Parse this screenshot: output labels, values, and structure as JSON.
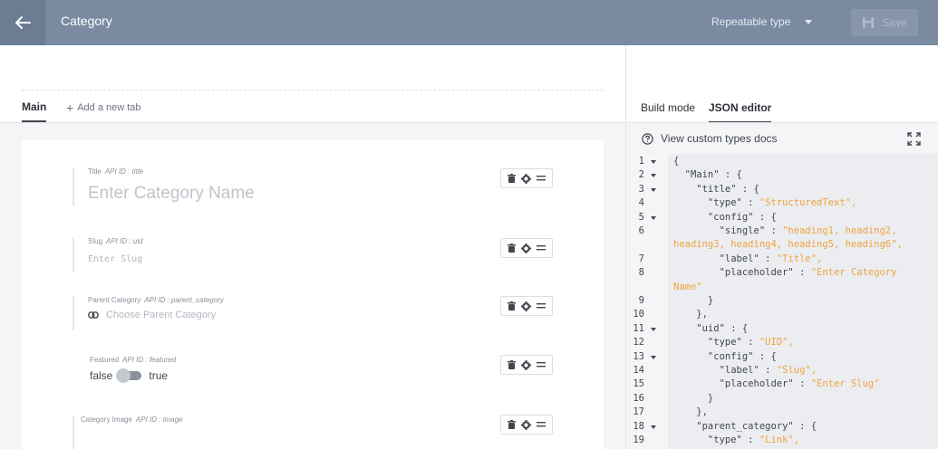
{
  "header": {
    "title": "Category",
    "type_select": "Repeatable type",
    "save_label": "Save"
  },
  "tabs": {
    "main": "Main",
    "add": "Add a new tab"
  },
  "fields": [
    {
      "label": "Title",
      "api": "API ID : title",
      "placeholder": "Enter Category Name"
    },
    {
      "label": "Slug",
      "api": "API ID : uid",
      "placeholder": "Enter Slug"
    },
    {
      "label": "Parent Category",
      "api": "API ID : parent_category",
      "placeholder": "Choose Parent Category"
    },
    {
      "label": "Featured",
      "api": "API ID : featured",
      "false_label": "false",
      "true_label": "true"
    },
    {
      "label": "Category Image",
      "api": "API ID : image"
    }
  ],
  "right": {
    "build_mode": "Build mode",
    "json_editor": "JSON editor",
    "docs_link": "View custom types docs"
  },
  "code": {
    "line_numbers": [
      "1",
      "2",
      "3",
      "4",
      "5",
      "6",
      "",
      "7",
      "8",
      "",
      "9",
      "10",
      "11",
      "12",
      "13",
      "14",
      "15",
      "16",
      "17",
      "18",
      "19"
    ],
    "lines": [
      "{",
      "  \"Main\" : {",
      "    \"title\" : {",
      "      \"type\" : ",
      "      \"config\" : {",
      "        \"single\" : ",
      "",
      "        \"label\" : ",
      "        \"placeholder\" : ",
      "",
      "      }",
      "    },",
      "    \"uid\" : {",
      "      \"type\" : ",
      "      \"config\" : {",
      "        \"label\" : ",
      "        \"placeholder\" : ",
      "      }",
      "    },",
      "    \"parent_category\" : {",
      "      \"type\" : "
    ],
    "strings": [
      "",
      "",
      "",
      "\"StructuredText\",",
      "",
      "\"heading1, heading2,",
      "heading3, heading4, heading5, heading6\",",
      "\"Title\",",
      "\"Enter Category",
      "Name\"",
      "",
      "",
      "",
      "\"UID\",",
      "",
      "\"Slug\",",
      "\"Enter Slug\"",
      "",
      "",
      "",
      "\"Link\","
    ]
  }
}
